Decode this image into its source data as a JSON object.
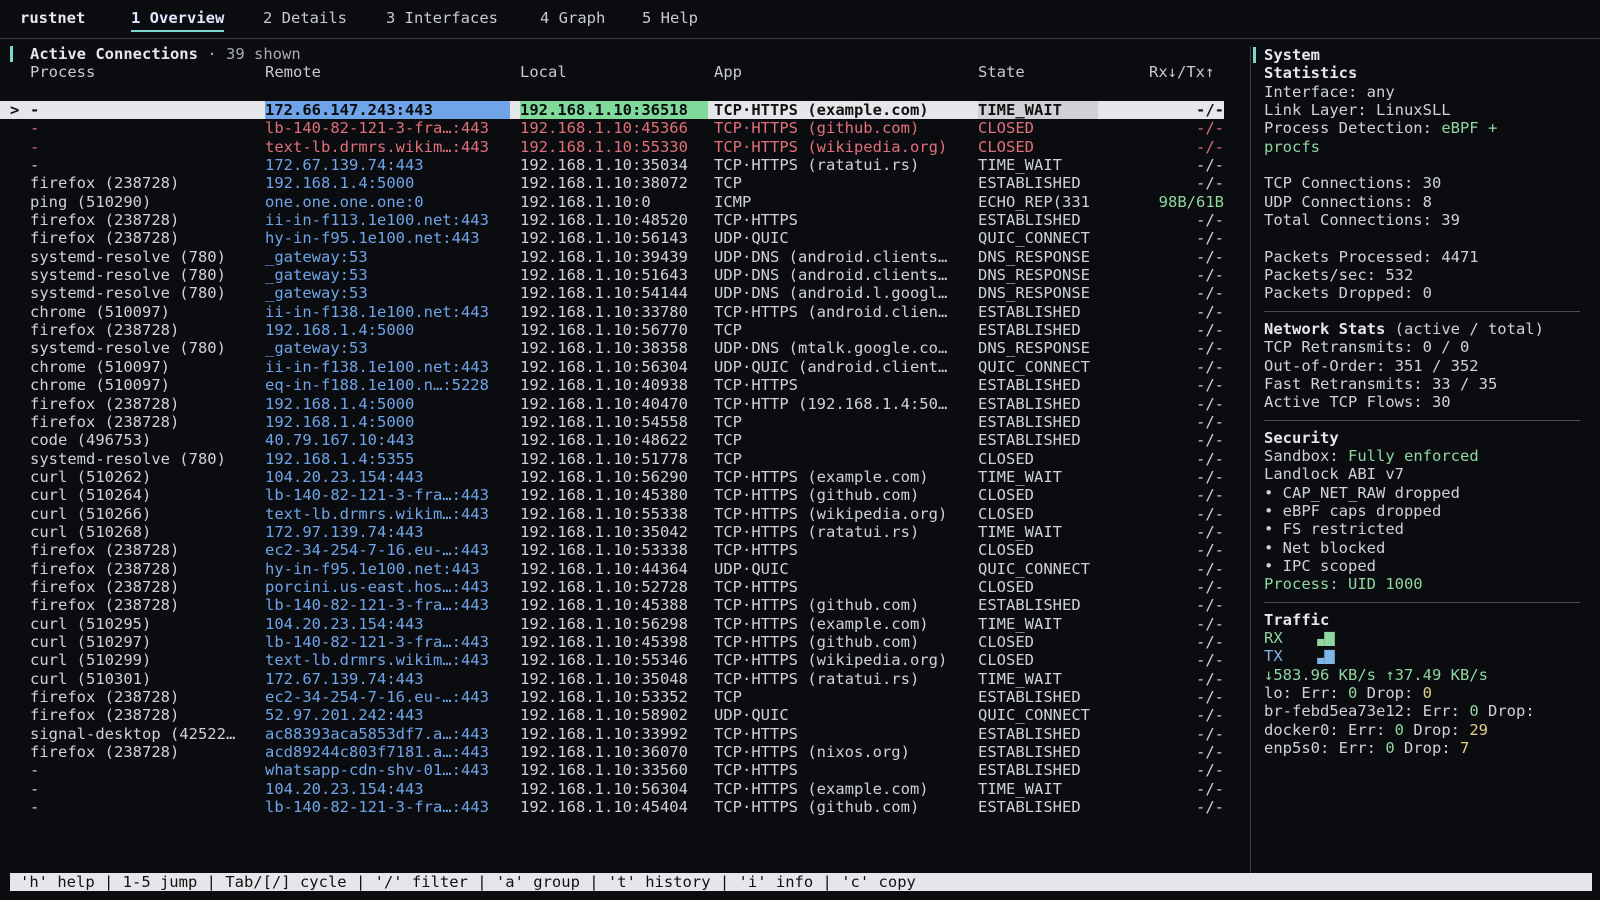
{
  "app_name": "rustnet",
  "tabs": [
    {
      "label": "1 Overview"
    },
    {
      "label": "2 Details"
    },
    {
      "label": "3 Interfaces"
    },
    {
      "label": "4 Graph"
    },
    {
      "label": "5 Help"
    }
  ],
  "connections": {
    "title": "Active Connections",
    "shown": "· 39 shown",
    "headers": {
      "process": "Process",
      "remote": "Remote",
      "local": "Local",
      "app": "App",
      "state": "State",
      "rxtx": "Rx↓/Tx↑"
    },
    "rows": [
      {
        "marker": ">",
        "process": "-",
        "remote": "172.66.147.243:443",
        "local": "192.168.1.10:36518",
        "app": "TCP·HTTPS (example.com)",
        "state": "TIME_WAIT",
        "rxtx": "-/-",
        "selected": true
      },
      {
        "process": "-",
        "remote": "lb-140-82-121-3-fra…:443",
        "local": "192.168.1.10:45366",
        "app": "TCP·HTTPS (github.com)",
        "state": "CLOSED",
        "rxtx": "-/-",
        "red": true
      },
      {
        "process": "-",
        "remote": "text-lb.drmrs.wikim…:443",
        "local": "192.168.1.10:55330",
        "app": "TCP·HTTPS (wikipedia.org)",
        "state": "CLOSED",
        "rxtx": "-/-",
        "red": true
      },
      {
        "process": "-",
        "remote": "172.67.139.74:443",
        "local": "192.168.1.10:35034",
        "app": "TCP·HTTPS (ratatui.rs)",
        "state": "TIME_WAIT",
        "rxtx": "-/-"
      },
      {
        "process": "firefox (238728)",
        "remote": "192.168.1.4:5000",
        "local": "192.168.1.10:38072",
        "app": "TCP",
        "state": "ESTABLISHED",
        "rxtx": "-/-"
      },
      {
        "process": "ping (510290)",
        "remote": "one.one.one.one:0",
        "local": "192.168.1.10:0",
        "app": "ICMP",
        "state": "ECHO_REP(331",
        "rxtx": "98B/61B",
        "green": true
      },
      {
        "process": "firefox (238728)",
        "remote": "ii-in-f113.1e100.net:443",
        "local": "192.168.1.10:48520",
        "app": "TCP·HTTPS",
        "state": "ESTABLISHED",
        "rxtx": "-/-"
      },
      {
        "process": "firefox (238728)",
        "remote": "hy-in-f95.1e100.net:443",
        "local": "192.168.1.10:56143",
        "app": "UDP·QUIC",
        "state": "QUIC_CONNECT",
        "rxtx": "-/-"
      },
      {
        "process": "systemd-resolve (780)",
        "remote": "_gateway:53",
        "local": "192.168.1.10:39439",
        "app": "UDP·DNS (android.clients…",
        "state": "DNS_RESPONSE",
        "rxtx": "-/-"
      },
      {
        "process": "systemd-resolve (780)",
        "remote": "_gateway:53",
        "local": "192.168.1.10:51643",
        "app": "UDP·DNS (android.clients…",
        "state": "DNS_RESPONSE",
        "rxtx": "-/-"
      },
      {
        "process": "systemd-resolve (780)",
        "remote": "_gateway:53",
        "local": "192.168.1.10:54144",
        "app": "UDP·DNS (android.l.googl…",
        "state": "DNS_RESPONSE",
        "rxtx": "-/-"
      },
      {
        "process": "chrome (510097)",
        "remote": "ii-in-f138.1e100.net:443",
        "local": "192.168.1.10:33780",
        "app": "TCP·HTTPS (android.clien…",
        "state": "ESTABLISHED",
        "rxtx": "-/-"
      },
      {
        "process": "firefox (238728)",
        "remote": "192.168.1.4:5000",
        "local": "192.168.1.10:56770",
        "app": "TCP",
        "state": "ESTABLISHED",
        "rxtx": "-/-"
      },
      {
        "process": "systemd-resolve (780)",
        "remote": "_gateway:53",
        "local": "192.168.1.10:38358",
        "app": "UDP·DNS (mtalk.google.co…",
        "state": "DNS_RESPONSE",
        "rxtx": "-/-"
      },
      {
        "process": "chrome (510097)",
        "remote": "ii-in-f138.1e100.net:443",
        "local": "192.168.1.10:56304",
        "app": "UDP·QUIC (android.client…",
        "state": "QUIC_CONNECT",
        "rxtx": "-/-"
      },
      {
        "process": "chrome (510097)",
        "remote": "eq-in-f188.1e100.n…:5228",
        "local": "192.168.1.10:40938",
        "app": "TCP·HTTPS",
        "state": "ESTABLISHED",
        "rxtx": "-/-"
      },
      {
        "process": "firefox (238728)",
        "remote": "192.168.1.4:5000",
        "local": "192.168.1.10:40470",
        "app": "TCP·HTTP (192.168.1.4:50…",
        "state": "ESTABLISHED",
        "rxtx": "-/-"
      },
      {
        "process": "firefox (238728)",
        "remote": "192.168.1.4:5000",
        "local": "192.168.1.10:54558",
        "app": "TCP",
        "state": "ESTABLISHED",
        "rxtx": "-/-"
      },
      {
        "process": "code (496753)",
        "remote": "40.79.167.10:443",
        "local": "192.168.1.10:48622",
        "app": "TCP",
        "state": "ESTABLISHED",
        "rxtx": "-/-"
      },
      {
        "process": "systemd-resolve (780)",
        "remote": "192.168.1.4:5355",
        "local": "192.168.1.10:51778",
        "app": "TCP",
        "state": "CLOSED",
        "rxtx": "-/-"
      },
      {
        "process": "curl (510262)",
        "remote": "104.20.23.154:443",
        "local": "192.168.1.10:56290",
        "app": "TCP·HTTPS (example.com)",
        "state": "TIME_WAIT",
        "rxtx": "-/-"
      },
      {
        "process": "curl (510264)",
        "remote": "lb-140-82-121-3-fra…:443",
        "local": "192.168.1.10:45380",
        "app": "TCP·HTTPS (github.com)",
        "state": "CLOSED",
        "rxtx": "-/-"
      },
      {
        "process": "curl (510266)",
        "remote": "text-lb.drmrs.wikim…:443",
        "local": "192.168.1.10:55338",
        "app": "TCP·HTTPS (wikipedia.org)",
        "state": "CLOSED",
        "rxtx": "-/-"
      },
      {
        "process": "curl (510268)",
        "remote": "172.97.139.74:443",
        "local": "192.168.1.10:35042",
        "app": "TCP·HTTPS (ratatui.rs)",
        "state": "TIME_WAIT",
        "rxtx": "-/-"
      },
      {
        "process": "firefox (238728)",
        "remote": "ec2-34-254-7-16.eu-…:443",
        "local": "192.168.1.10:53338",
        "app": "TCP·HTTPS",
        "state": "CLOSED",
        "rxtx": "-/-"
      },
      {
        "process": "firefox (238728)",
        "remote": "hy-in-f95.1e100.net:443",
        "local": "192.168.1.10:44364",
        "app": "UDP·QUIC",
        "state": "QUIC_CONNECT",
        "rxtx": "-/-"
      },
      {
        "process": "firefox (238728)",
        "remote": "porcini.us-east.hos…:443",
        "local": "192.168.1.10:52728",
        "app": "TCP·HTTPS",
        "state": "CLOSED",
        "rxtx": "-/-"
      },
      {
        "process": "firefox (238728)",
        "remote": "lb-140-82-121-3-fra…:443",
        "local": "192.168.1.10:45388",
        "app": "TCP·HTTPS (github.com)",
        "state": "ESTABLISHED",
        "rxtx": "-/-"
      },
      {
        "process": "curl (510295)",
        "remote": "104.20.23.154:443",
        "local": "192.168.1.10:56298",
        "app": "TCP·HTTPS (example.com)",
        "state": "TIME_WAIT",
        "rxtx": "-/-"
      },
      {
        "process": "curl (510297)",
        "remote": "lb-140-82-121-3-fra…:443",
        "local": "192.168.1.10:45398",
        "app": "TCP·HTTPS (github.com)",
        "state": "CLOSED",
        "rxtx": "-/-"
      },
      {
        "process": "curl (510299)",
        "remote": "text-lb.drmrs.wikim…:443",
        "local": "192.168.1.10:55346",
        "app": "TCP·HTTPS (wikipedia.org)",
        "state": "CLOSED",
        "rxtx": "-/-"
      },
      {
        "process": "curl (510301)",
        "remote": "172.67.139.74:443",
        "local": "192.168.1.10:35048",
        "app": "TCP·HTTPS (ratatui.rs)",
        "state": "TIME_WAIT",
        "rxtx": "-/-"
      },
      {
        "process": "firefox (238728)",
        "remote": "ec2-34-254-7-16.eu-…:443",
        "local": "192.168.1.10:53352",
        "app": "TCP",
        "state": "ESTABLISHED",
        "rxtx": "-/-"
      },
      {
        "process": "firefox (238728)",
        "remote": "52.97.201.242:443",
        "local": "192.168.1.10:58902",
        "app": "UDP·QUIC",
        "state": "QUIC_CONNECT",
        "rxtx": "-/-"
      },
      {
        "process": "signal-desktop (42522…",
        "remote": "ac88393aca5853df7.a…:443",
        "local": "192.168.1.10:33992",
        "app": "TCP·HTTPS",
        "state": "ESTABLISHED",
        "rxtx": "-/-"
      },
      {
        "process": "firefox (238728)",
        "remote": "acd89244c803f7181.a…:443",
        "local": "192.168.1.10:36070",
        "app": "TCP·HTTPS (nixos.org)",
        "state": "ESTABLISHED",
        "rxtx": "-/-"
      },
      {
        "process": "-",
        "remote": "whatsapp-cdn-shv-01…:443",
        "local": "192.168.1.10:33560",
        "app": "TCP·HTTPS",
        "state": "ESTABLISHED",
        "rxtx": "-/-"
      },
      {
        "process": "-",
        "remote": "104.20.23.154:443",
        "local": "192.168.1.10:56304",
        "app": "TCP·HTTPS (example.com)",
        "state": "TIME_WAIT",
        "rxtx": "-/-"
      },
      {
        "process": "-",
        "remote": "lb-140-82-121-3-fra…:443",
        "local": "192.168.1.10:45404",
        "app": "TCP·HTTPS (github.com)",
        "state": "ESTABLISHED",
        "rxtx": "-/-"
      }
    ]
  },
  "system": {
    "title": "System",
    "statistics_label": "Statistics",
    "interface": "Interface: any",
    "link_layer": "Link Layer: LinuxSLL",
    "process_detection_label": "Process Detection: ",
    "process_detection_value": "eBPF +",
    "process_detection_value2": "procfs",
    "tcp_connections": "TCP Connections: 30",
    "udp_connections": "UDP Connections: 8",
    "total_connections": "Total Connections: 39",
    "packets_processed": "Packets Processed: 4471",
    "packets_sec": "Packets/sec: 532",
    "packets_dropped": "Packets Dropped: 0",
    "network_stats_label": "Network Stats",
    "network_stats_suffix": " (active / total)",
    "tcp_retransmits": "TCP Retransmits: 0 / 0",
    "out_of_order": "Out-of-Order: 351 / 352",
    "fast_retransmits": "Fast Retransmits: 33 / 35",
    "active_tcp_flows": "Active TCP Flows: 30",
    "security_label": "Security",
    "sandbox_label": "Sandbox: ",
    "sandbox_value": "Fully enforced",
    "landlock": "Landlock ABI v7",
    "bullets": [
      "• CAP_NET_RAW dropped",
      "• eBPF caps dropped",
      "• FS restricted",
      "• Net blocked",
      "• IPC scoped"
    ],
    "process_uid": "Process: UID 1000",
    "traffic_label": "Traffic",
    "rx_label": "RX",
    "tx_label": "TX",
    "rate_line": "↓583.96 KB/s ↑37.49 KB/s",
    "iface_stats": [
      {
        "prefix": "lo: Err: ",
        "err": "0",
        "mid": "  Drop: ",
        "drop": "0"
      },
      {
        "prefix": "br-febd5ea73e12: Err: ",
        "err": "0",
        "mid": "  Drop:",
        "drop": ""
      },
      {
        "prefix": "docker0: Err: ",
        "err": "0",
        "mid": "  Drop: ",
        "drop": "29"
      },
      {
        "prefix": "enp5s0: Err: ",
        "err": "0",
        "mid": "  Drop: ",
        "drop": "7"
      }
    ]
  },
  "colors": {
    "accent": "#7fd6cf",
    "remote": "#6fa4e8",
    "closed": "#e0707a",
    "green": "#8fd6a0",
    "yellow": "#e6d28a"
  },
  "status_bar": "'h' help | 1-5 jump | Tab/[/] cycle | '/' filter | 'a' group | 't' history | 'i' info | 'c' copy"
}
